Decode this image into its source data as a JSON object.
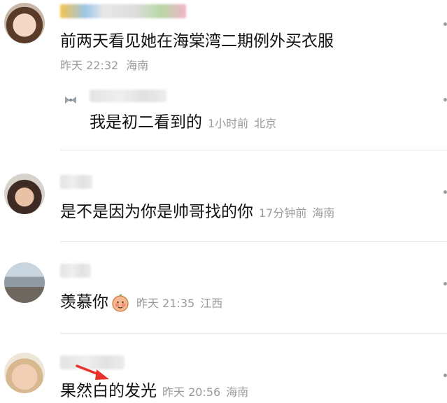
{
  "comments": [
    {
      "text": "前两天看见她在海棠湾二期例外买衣服",
      "time": "昨天 22:32",
      "location": "海南",
      "reply": {
        "text": "我是初二看到的",
        "time": "1小时前",
        "location": "北京"
      }
    },
    {
      "text": "是不是因为你是帅哥找的你",
      "time": "17分钟前",
      "location": "海南"
    },
    {
      "text": "羡慕你",
      "emoji": "shy-face-emoji",
      "time": "昨天 21:35",
      "location": "江西"
    },
    {
      "text": "果然白的发光",
      "time": "昨天 20:56",
      "location": "海南"
    }
  ],
  "colors": {
    "meta": "#9a9a9a",
    "annotation_arrow": "#e8322b"
  }
}
